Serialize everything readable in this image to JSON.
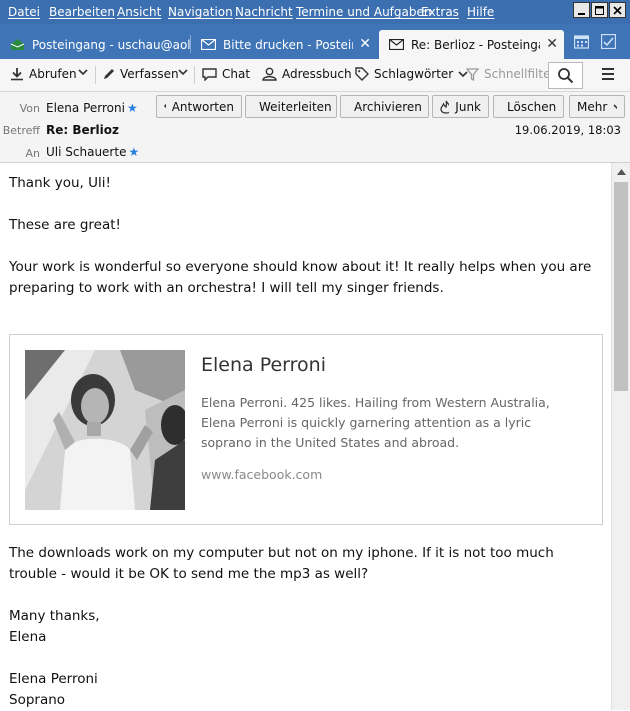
{
  "menu": {
    "items": [
      "Datei",
      "Bearbeiten",
      "Ansicht",
      "Navigation",
      "Nachricht",
      "Termine und Aufgaben",
      "Extras",
      "Hilfe"
    ]
  },
  "tabs": [
    {
      "label": "Posteingang - uschau@aol.com",
      "icon": "inbox-icon"
    },
    {
      "label": "Bitte drucken - Posteingang - uschau@aol.com",
      "icon": "envelope-icon"
    },
    {
      "label": "Re: Berlioz - Posteingang - uschau@aol.com",
      "icon": "envelope-icon",
      "active": true
    }
  ],
  "toolbar": {
    "get_messages": "Abrufen",
    "write": "Verfassen",
    "chat": "Chat",
    "address_book": "Adressbuch",
    "tags": "Schlagwörter",
    "quick_filter": "Schnellfilter"
  },
  "header": {
    "from_label": "Von",
    "from_value": "Elena Perroni",
    "subject_label": "Betreff",
    "subject_value": "Re: Berlioz",
    "to_label": "An",
    "to_value": "Uli Schauerte",
    "date": "19.06.2019, 18:03",
    "buttons": {
      "reply": "Antworten",
      "forward": "Weiterleiten",
      "archive": "Archivieren",
      "junk": "Junk",
      "delete": "Löschen",
      "more": "Mehr"
    }
  },
  "body": {
    "p1": "Thank you, Uli!",
    "p2": "These are great!",
    "p3": "Your work is wonderful so everyone should know about it! It really helps when you are preparing to work with an orchestra! I will tell my singer friends.",
    "preview": {
      "title": "Elena Perroni",
      "description": "Elena Perroni. 425 likes. Hailing from Western Australia, Elena Perroni is quickly garnering attention as a lyric soprano in the United States and abroad.",
      "url": "www.facebook.com"
    },
    "p4": "The downloads work on my computer but not on my iphone. If it is not too much trouble - would it be OK to send me the mp3 as well?",
    "p5a": "Many thanks,",
    "p5b": "Elena",
    "sig1": "Elena Perroni",
    "sig2": "Soprano"
  },
  "colors": {
    "menubar": "#3b6fb0",
    "tabbar": "#3f74b7",
    "star": "#2a7fde"
  }
}
